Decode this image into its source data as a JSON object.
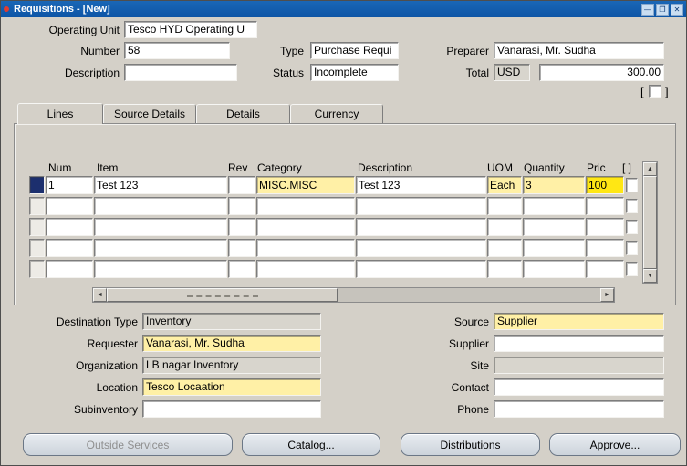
{
  "window": {
    "title": "Requisitions - [New]",
    "controls": [
      {
        "name": "minimize",
        "glyph": "—"
      },
      {
        "name": "maximize",
        "glyph": "❐"
      },
      {
        "name": "close",
        "glyph": "✕"
      }
    ]
  },
  "header": {
    "operating_unit": {
      "label": "Operating Unit",
      "value": "Tesco HYD Operating U"
    },
    "number": {
      "label": "Number",
      "value": "58"
    },
    "type": {
      "label": "Type",
      "value": "Purchase Requi"
    },
    "preparer": {
      "label": "Preparer",
      "value": "Vanarasi, Mr. Sudha"
    },
    "description": {
      "label": "Description",
      "value": ""
    },
    "status": {
      "label": "Status",
      "value": "Incomplete"
    },
    "total": {
      "label": "Total",
      "currency": "USD",
      "amount": "300.00"
    },
    "flexfield": {
      "open": "[",
      "close": "]"
    }
  },
  "tabs": [
    {
      "label": "Lines",
      "active": true
    },
    {
      "label": "Source Details",
      "active": false
    },
    {
      "label": "Details",
      "active": false
    },
    {
      "label": "Currency",
      "active": false
    }
  ],
  "table": {
    "columns": [
      "Num",
      "Item",
      "Rev",
      "Category",
      "Description",
      "UOM",
      "Quantity",
      "Pric",
      "[ ]"
    ],
    "rows": [
      {
        "selected": true,
        "cells": [
          {
            "col": "num",
            "value": "1",
            "bg": "white"
          },
          {
            "col": "item",
            "value": "Test 123",
            "bg": "white"
          },
          {
            "col": "rev",
            "value": "",
            "bg": "white"
          },
          {
            "col": "category",
            "value": "MISC.MISC",
            "bg": "required"
          },
          {
            "col": "description",
            "value": "Test 123",
            "bg": "white"
          },
          {
            "col": "uom",
            "value": "Each",
            "bg": "required"
          },
          {
            "col": "quantity",
            "value": "3",
            "bg": "required"
          },
          {
            "col": "price",
            "value": "100",
            "bg": "highlight"
          },
          {
            "col": "flex",
            "value": "",
            "bg": "white"
          }
        ]
      }
    ],
    "empty_row_count": 4
  },
  "details": {
    "left": [
      {
        "label": "Destination Type",
        "value": "Inventory",
        "style": "readonly"
      },
      {
        "label": "Requester",
        "value": "Vanarasi, Mr. Sudha",
        "style": "required"
      },
      {
        "label": "Organization",
        "value": "LB nagar Inventory",
        "style": "readonly"
      },
      {
        "label": "Location",
        "value": "Tesco Locaation",
        "style": "required"
      },
      {
        "label": "Subinventory",
        "value": "",
        "style": "normal"
      }
    ],
    "right": [
      {
        "label": "Source",
        "value": "Supplier",
        "style": "required"
      },
      {
        "label": "Supplier",
        "value": "",
        "style": "normal"
      },
      {
        "label": "Site",
        "value": "",
        "style": "readonly"
      },
      {
        "label": "Contact",
        "value": "",
        "style": "normal"
      },
      {
        "label": "Phone",
        "value": "",
        "style": "normal"
      }
    ]
  },
  "buttons": [
    {
      "label": "Outside Services",
      "disabled": true
    },
    {
      "label": "Catalog...",
      "disabled": false
    },
    {
      "label": "Distributions",
      "disabled": false
    },
    {
      "label": "Approve...",
      "disabled": false
    }
  ],
  "colors": {
    "title_bar": "#0d55a6",
    "canvas": "#d4d0c8",
    "required_field": "#fff0a6",
    "active_field": "#ffe714",
    "selected_row": "#1c2f6e",
    "disabled_text": "#8f8f8f"
  }
}
